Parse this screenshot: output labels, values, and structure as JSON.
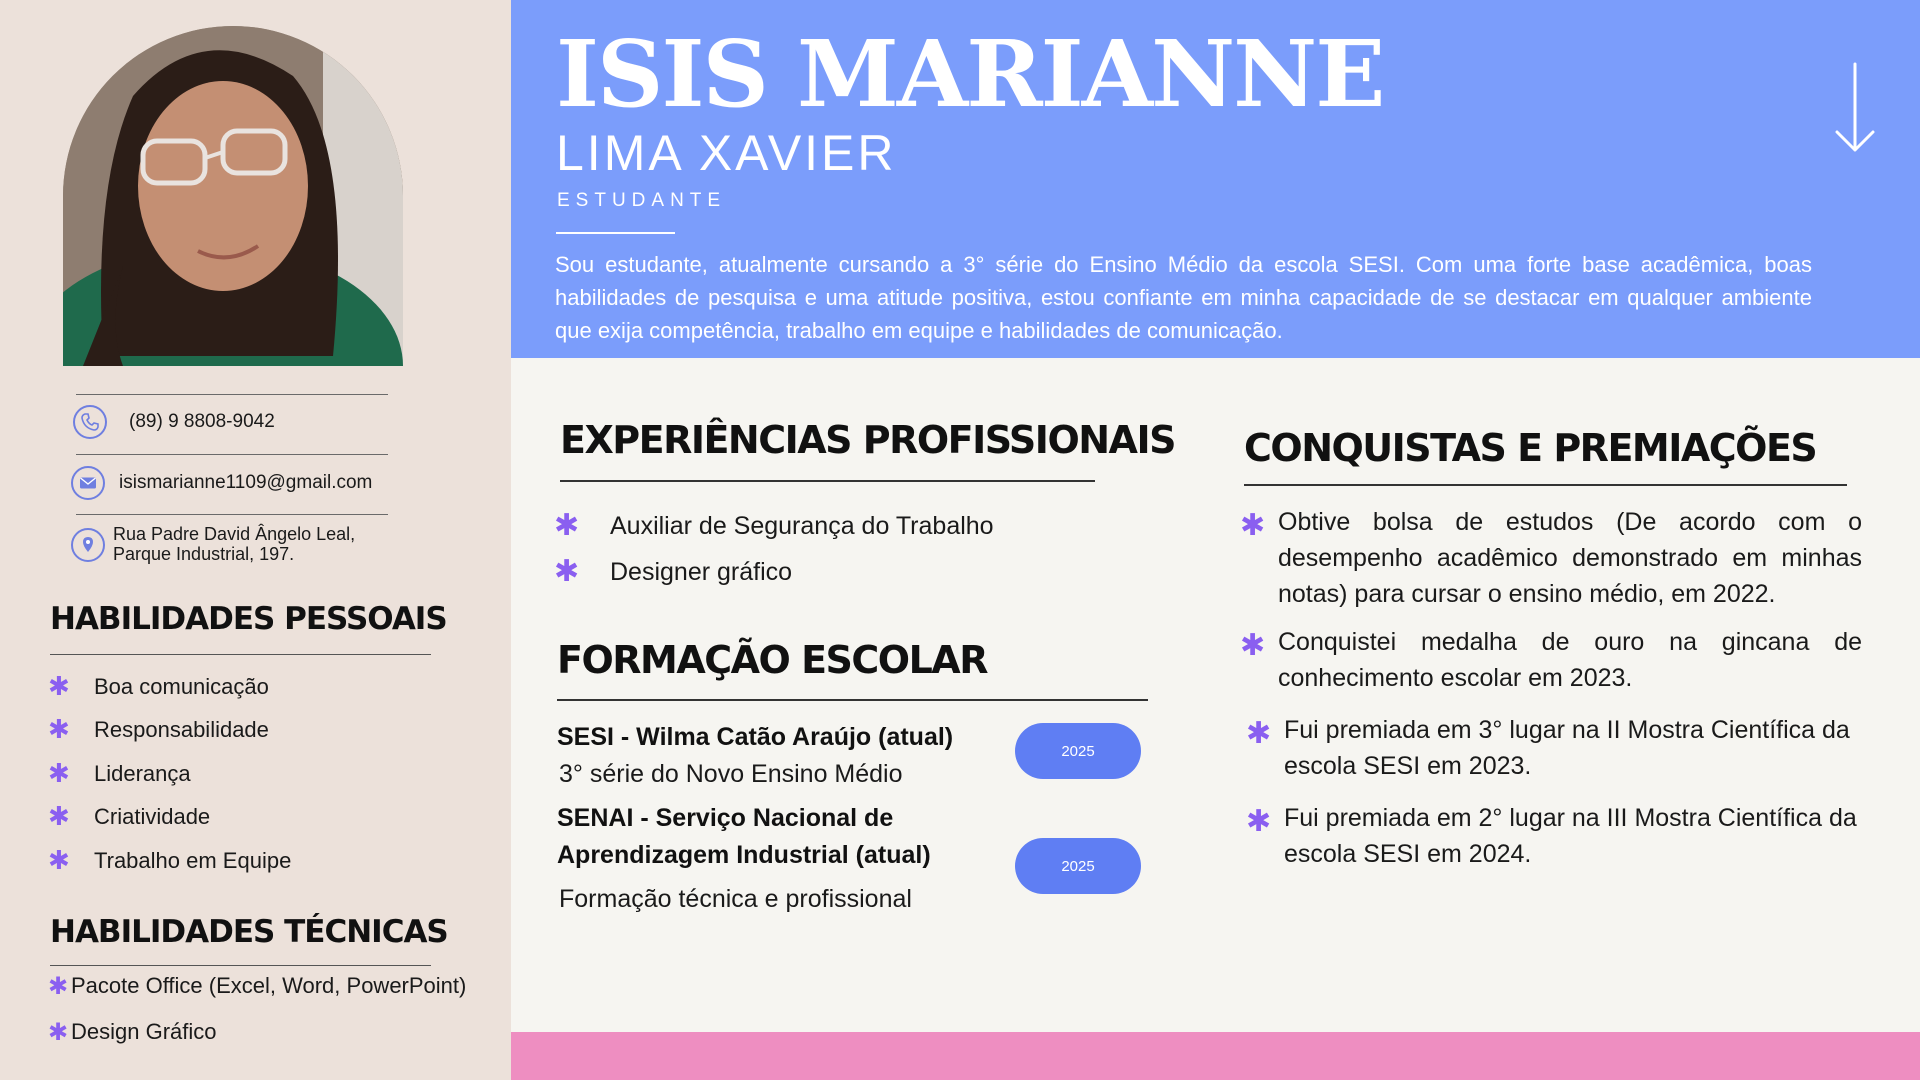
{
  "header": {
    "name_first": "ISIS MARIANNE",
    "name_last": "LIMA XAVIER",
    "role": "ESTUDANTE",
    "bio": "Sou estudante, atualmente cursando a 3° série do Ensino Médio da escola SESI. Com uma forte base acadêmica, boas habilidades de pesquisa e uma atitude positiva, estou confiante em minha capacidade de se destacar em qualquer ambiente que exija competência, trabalho em equipe e habilidades de comunicação.",
    "arrow_icon": "arrow-down-icon"
  },
  "contact": {
    "phone": "(89) 9 8808-9042",
    "email": "isismarianne1109@gmail.com",
    "address_line1": "Rua Padre David Ângelo Leal,",
    "address_line2": "Parque Industrial, 197."
  },
  "personal_skills": {
    "title": "HABILIDADES PESSOAIS",
    "items": [
      "Boa comunicação",
      "Responsabilidade",
      "Liderança",
      "Criatividade",
      "Trabalho em Equipe"
    ]
  },
  "technical_skills": {
    "title": "HABILIDADES TÉCNICAS",
    "items": [
      "Pacote Office (Excel, Word, PowerPoint)",
      "Design Gráfico"
    ]
  },
  "experience": {
    "title": "EXPERIÊNCIAS PROFISSIONAIS",
    "items": [
      "Auxiliar de Segurança do Trabalho",
      "Designer gráfico"
    ]
  },
  "education": {
    "title": "FORMAÇÃO ESCOLAR",
    "entries": [
      {
        "title": "SESI - Wilma Catão Araújo  (atual)",
        "detail": "3° série do Novo Ensino Médio",
        "year": "2025"
      },
      {
        "title_line1": "SENAI - Serviço Nacional de",
        "title_line2": "Aprendizagem Industrial (atual)",
        "detail": "Formação técnica e profissional",
        "year": "2025"
      }
    ]
  },
  "awards": {
    "title": "CONQUISTAS E PREMIAÇÕES",
    "items": [
      "Obtive bolsa de estudos (De acordo com o desempenho acadêmico demonstrado em minhas notas) para cursar o ensino médio, em 2022.",
      "Conquistei medalha de ouro na gincana de conhecimento escolar em 2023.",
      "Fui premiada em 3° lugar na II Mostra Científica da escola SESI em 2023.",
      "Fui premiada em 2° lugar na III Mostra Científica da escola SESI em 2024."
    ]
  },
  "colors": {
    "header_bg": "#7b9dfb",
    "sidebar_bg": "#ece1da",
    "accent_star": "#8a5ff0",
    "pill_bg": "#5f7ef3",
    "footer_bg": "#ee8ec1"
  }
}
